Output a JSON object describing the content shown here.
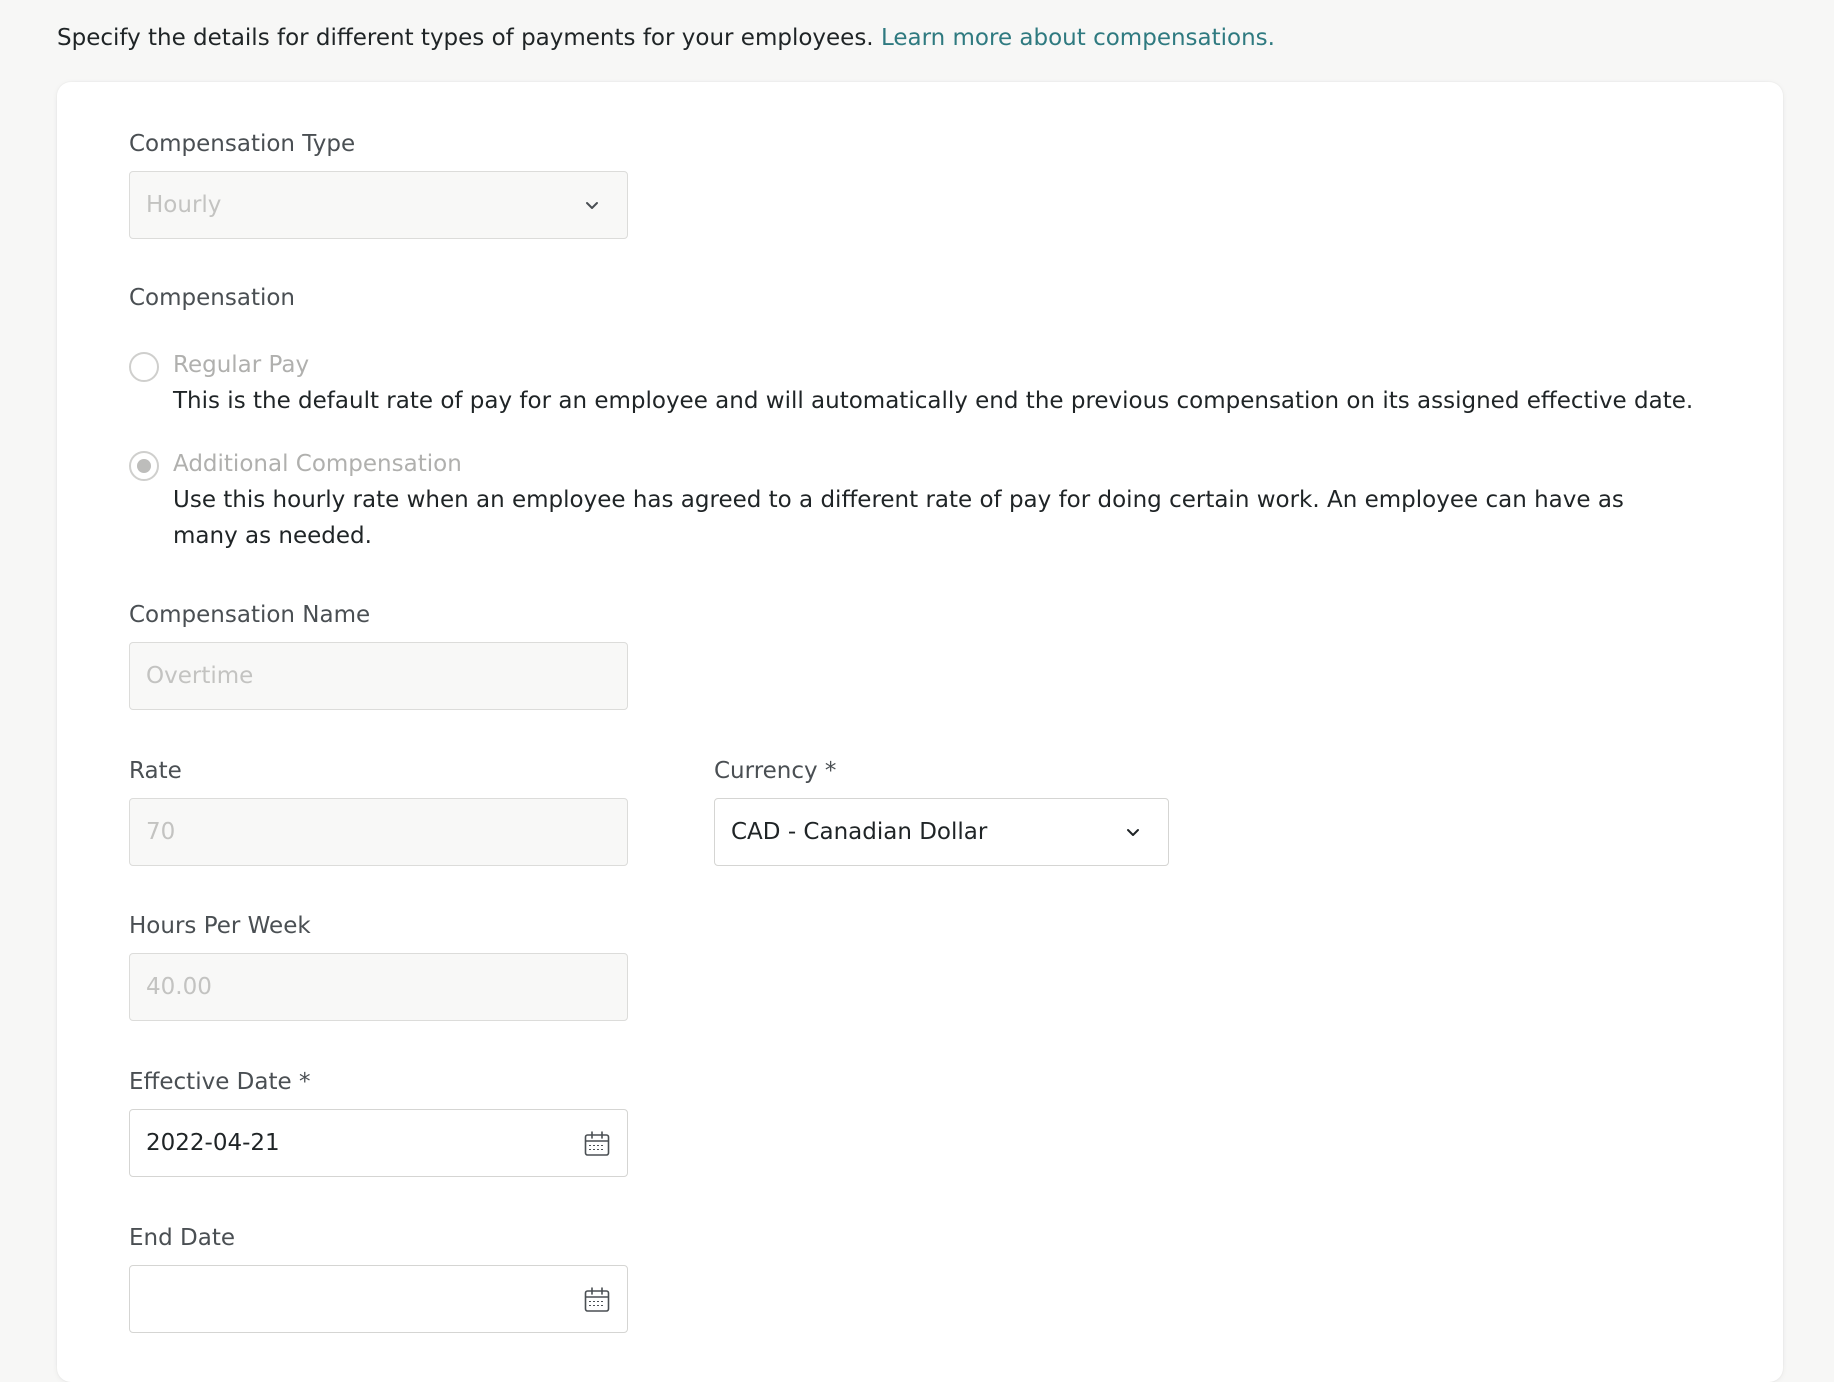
{
  "intro": {
    "text": "Specify the details for different types of payments for your employees.",
    "link": "Learn more about compensations."
  },
  "compensation_type": {
    "label": "Compensation Type",
    "value": "Hourly"
  },
  "compensation": {
    "label": "Compensation",
    "options": [
      {
        "title": "Regular Pay",
        "description": "This is the default rate of pay for an employee and will automatically end the previous compensation on its assigned effective date.",
        "checked": false
      },
      {
        "title": "Additional Compensation",
        "description": "Use this hourly rate when an employee has agreed to a different rate of pay for doing certain work. An employee can have as many as needed.",
        "checked": true
      }
    ]
  },
  "compensation_name": {
    "label": "Compensation Name",
    "placeholder": "Overtime"
  },
  "rate": {
    "label": "Rate",
    "placeholder": "70"
  },
  "currency": {
    "label": "Currency *",
    "value": "CAD - Canadian Dollar"
  },
  "hours_per_week": {
    "label": "Hours Per Week",
    "placeholder": "40.00"
  },
  "effective_date": {
    "label": "Effective Date *",
    "value": "2022-04-21"
  },
  "end_date": {
    "label": "End Date",
    "value": ""
  },
  "icons": {
    "dropdown": "chevron-down-icon",
    "date": "calendar-icon"
  }
}
